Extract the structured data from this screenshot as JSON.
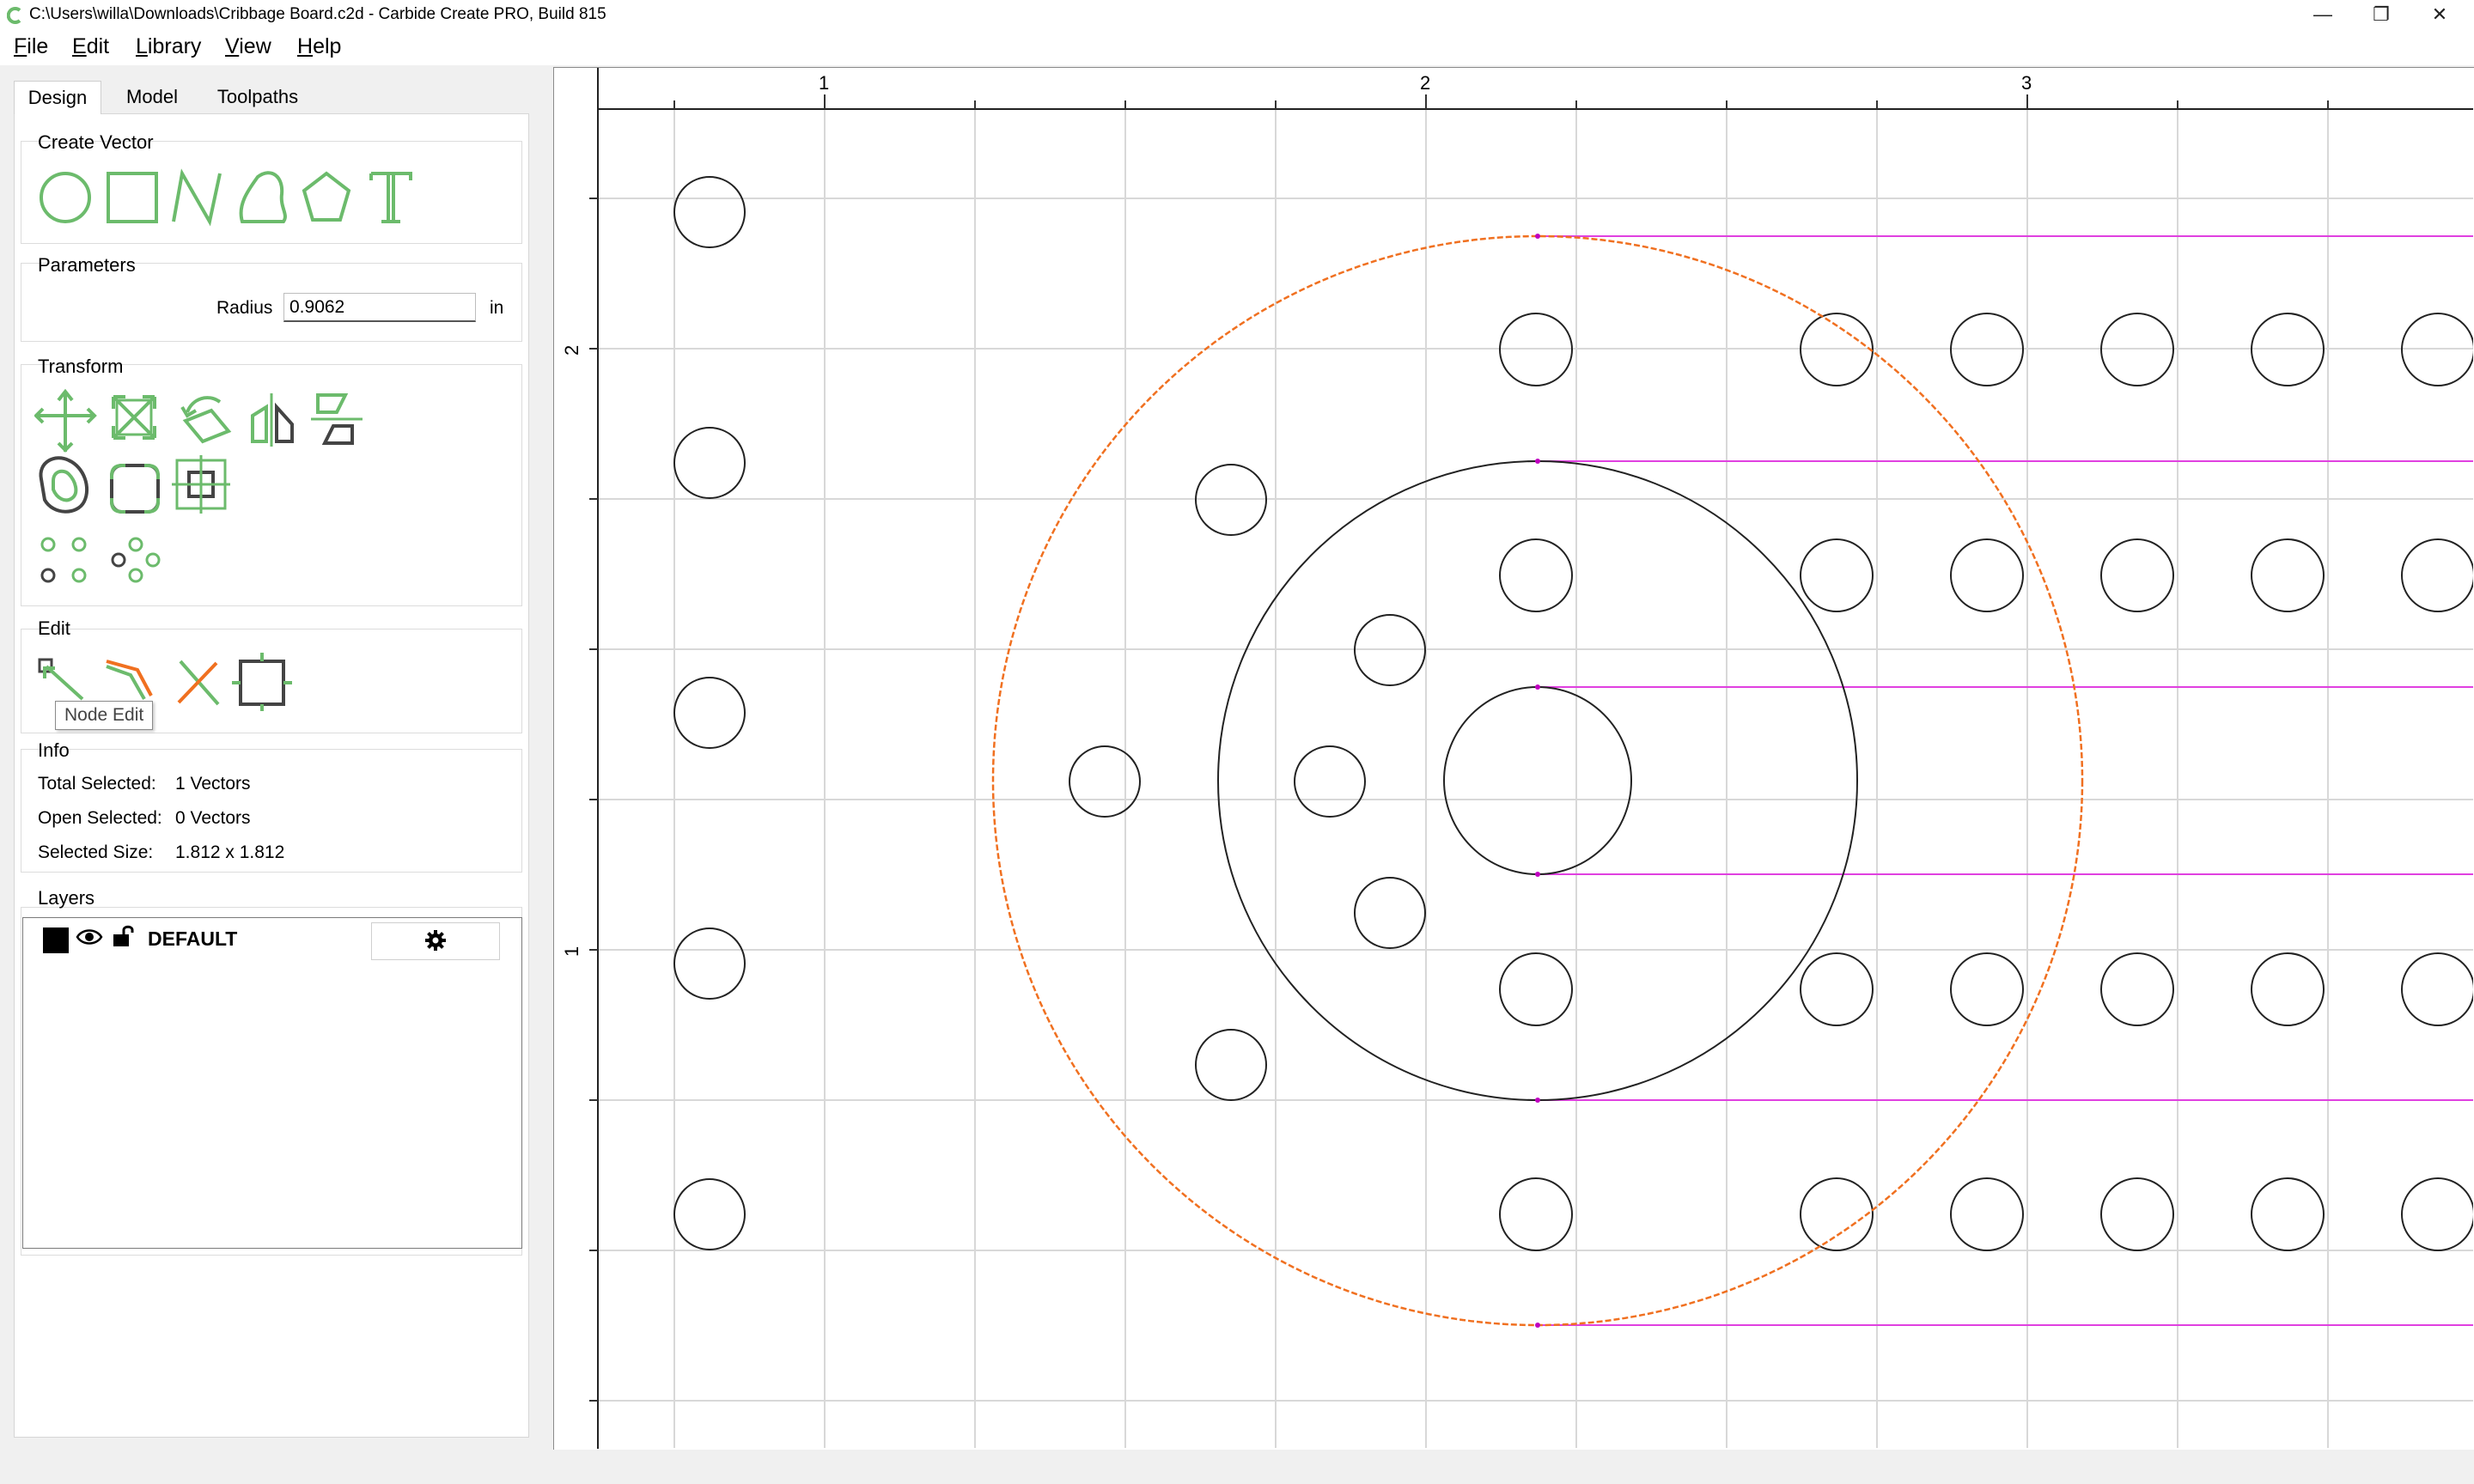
{
  "window": {
    "title": "C:\\Users\\willa\\Downloads\\Cribbage Board.c2d - Carbide Create PRO, Build 815",
    "minimize_glyph": "—",
    "restore_glyph": "❐",
    "close_glyph": "✕"
  },
  "menu": [
    "File",
    "Edit",
    "Library",
    "View",
    "Help"
  ],
  "tabs": [
    "Design",
    "Model",
    "Toolpaths"
  ],
  "create_vector": {
    "title": "Create Vector",
    "icons": [
      "circle-tool-icon",
      "rectangle-tool-icon",
      "polyline-tool-icon",
      "curve-tool-icon",
      "polygon-tool-icon",
      "text-tool-icon"
    ]
  },
  "parameters": {
    "title": "Parameters",
    "radius_label": "Radius",
    "radius_value": "0.9062",
    "radius_unit": "in"
  },
  "transform": {
    "title": "Transform",
    "icons": [
      "move-icon",
      "scale-icon",
      "rotate-icon",
      "mirror-icon",
      "align-icon",
      "offset-icon",
      "fillet-icon",
      "snap-icon",
      "circular-pattern-icon",
      "rectangular-pattern-icon"
    ]
  },
  "edit": {
    "title": "Edit",
    "icons": [
      "node-edit-icon",
      "trim-icon",
      "cut-icon",
      "boolean-icon"
    ],
    "tooltip": "Node Edit"
  },
  "info": {
    "title": "Info",
    "rows": [
      {
        "label": "Total Selected:",
        "value": "1 Vectors"
      },
      {
        "label": "Open Selected:",
        "value": "0 Vectors"
      },
      {
        "label": "Selected Size:",
        "value": "1.812 x 1.812"
      }
    ]
  },
  "layers": {
    "title": "Layers",
    "items": [
      {
        "name": "DEFAULT",
        "color": "#000000"
      }
    ]
  },
  "rulers": {
    "top_labels": [
      "1",
      "2",
      "3"
    ],
    "left_labels": [
      "2",
      "1"
    ]
  },
  "colors": {
    "accent_green": "#6cbb6c",
    "selection_orange": "#f07020",
    "guide_magenta": "#e040e0",
    "grid": "#d8d8d8"
  }
}
